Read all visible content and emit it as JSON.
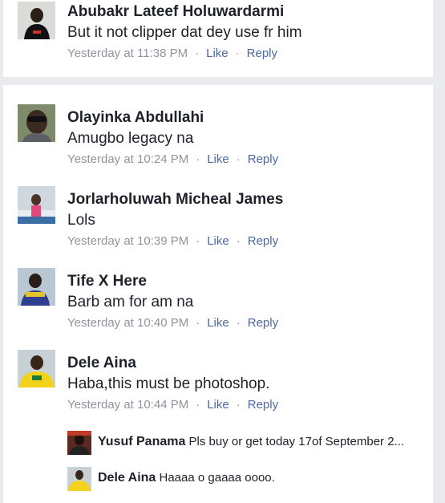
{
  "colors": {
    "background": "#e9ebee",
    "card": "#ffffff",
    "name": "#1d2129",
    "meta": "#90949c",
    "action": "#4b68a3"
  },
  "actions": {
    "like": "Like",
    "reply": "Reply",
    "separator": "·"
  },
  "top_comment": {
    "name": "Abubakr Lateef Holuwardarmi",
    "text": "But it not clipper dat dey use fr him",
    "time": "Yesterday at 11:38 PM"
  },
  "comments": [
    {
      "name": "Olayinka Abdullahi",
      "text": "Amugbo legacy na",
      "time": "Yesterday at 10:24 PM"
    },
    {
      "name": "Jorlarholuwah Micheal James",
      "text": "Lols",
      "time": "Yesterday at 10:39 PM"
    },
    {
      "name": "Tife X Here",
      "text": "Barb am for am na",
      "time": "Yesterday at 10:40 PM"
    },
    {
      "name": "Dele Aina",
      "text": "Haba,this must be photoshop.",
      "time": "Yesterday at 10:44 PM"
    }
  ],
  "replies": [
    {
      "name": "Yusuf Panama",
      "text": "Pls buy or get today 17of September 2..."
    },
    {
      "name": "Dele Aina",
      "text": "Haaaa o gaaaa oooo."
    }
  ]
}
